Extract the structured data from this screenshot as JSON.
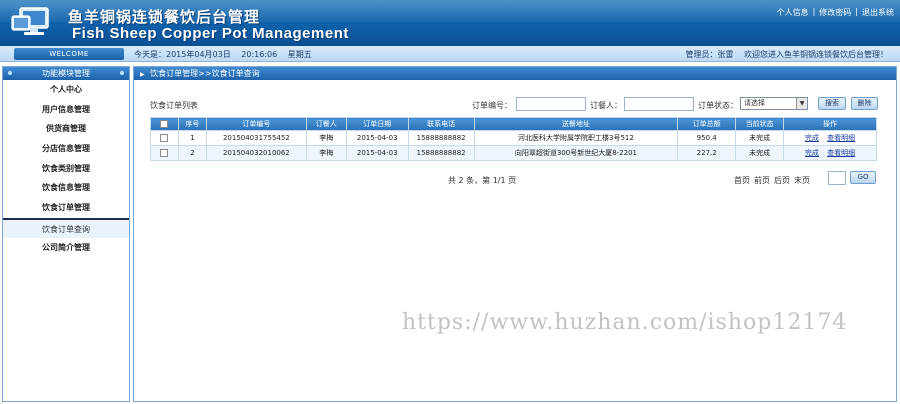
{
  "header": {
    "title_cn": "鱼羊铜锅连锁餐饮后台管理",
    "title_en": "Fish Sheep Copper Pot Management",
    "links": [
      "个人信息",
      "修改密码",
      "退出系统"
    ]
  },
  "statusbar": {
    "welcome": "WELCOME",
    "date": "今天是：2015年04月03日",
    "time": "20:16:06",
    "weekday": "星期五",
    "admin": "管理员：张雷",
    "greeting": "欢迎您进入鱼羊铜锅连锁餐饮后台管理！"
  },
  "sidebar": {
    "header": "功能模块管理",
    "items": [
      {
        "label": "个人中心"
      },
      {
        "label": "用户信息管理"
      },
      {
        "label": "供货商管理"
      },
      {
        "label": "分店信息管理"
      },
      {
        "label": "饮食类别管理"
      },
      {
        "label": "饮食信息管理"
      },
      {
        "label": "饮食订单管理"
      },
      {
        "label": "饮食订单查询"
      },
      {
        "label": "公司简介管理"
      }
    ]
  },
  "main": {
    "breadcrumb": "饮食订单管理>>饮食订单查询",
    "list_title": "饮食订单列表",
    "search": {
      "order_no_label": "订单编号：",
      "order_no_value": "",
      "buyer_label": "订餐人：",
      "buyer_value": "",
      "status_label": "订单状态：",
      "status_selected": "请选择",
      "search_btn": "搜索",
      "delete_btn": "删除"
    },
    "table": {
      "headers": [
        "",
        "序号",
        "订单编号",
        "订餐人",
        "订单日期",
        "联系电话",
        "送餐地址",
        "订单总额",
        "当前状态",
        "操作"
      ],
      "rows": [
        {
          "idx": "1",
          "order_no": "201504031755452",
          "buyer": "李梅",
          "date": "2015-04-03",
          "phone": "15888888882",
          "address": "河北医科大学附属学院职工楼3号512",
          "total": "950.4",
          "status": "未完成",
          "op1": "完成",
          "op2": "查看明细"
        },
        {
          "idx": "2",
          "order_no": "201504032010062",
          "buyer": "李梅",
          "date": "2015-04-03",
          "phone": "15888888882",
          "address": "向阳翠超街道300号新世纪大厦8-2201",
          "total": "227.2",
          "status": "未完成",
          "op1": "完成",
          "op2": "查看明细"
        }
      ]
    },
    "pager": {
      "info": "共 2 条，第 1/1 页",
      "first": "首页",
      "prev": "前页",
      "next": "后页",
      "last": "末页",
      "page_value": "",
      "go": "GO"
    }
  },
  "watermark": "https://www.huzhan.com/ishop12174",
  "colors": {
    "header_blue": "#0f5ea8",
    "table_head": "#2b71b8",
    "link": "#1b3fa0"
  },
  "icons": [
    "computer-monitor-icon",
    "arrow-right-icon",
    "dropdown-arrow-icon"
  ]
}
